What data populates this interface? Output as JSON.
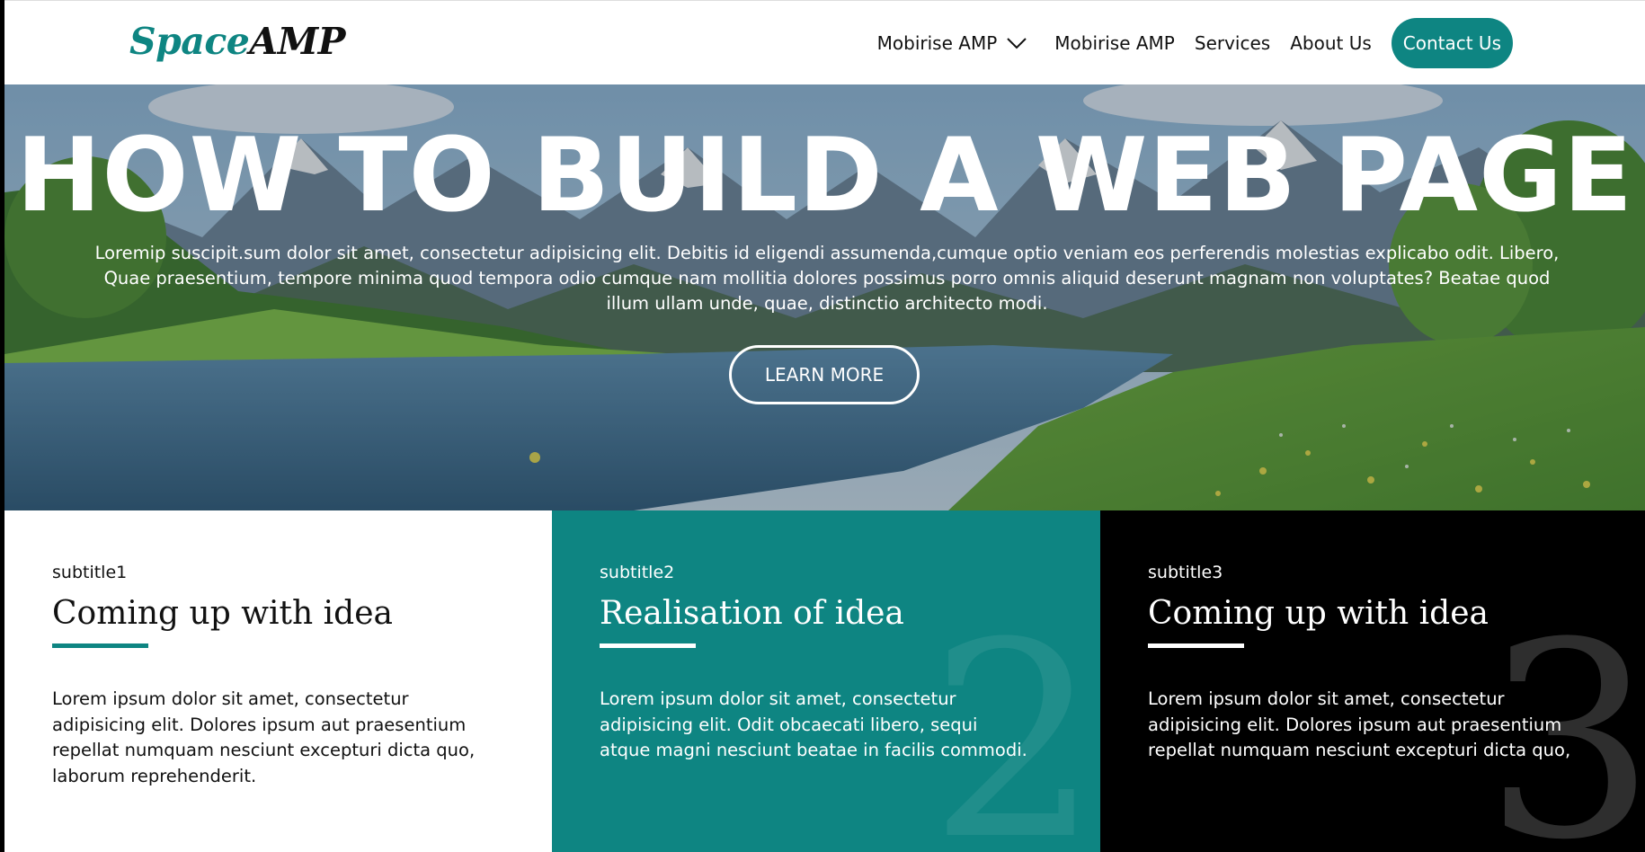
{
  "navbar": {
    "brand_part1": "Space",
    "brand_part2": "AMP",
    "items": [
      {
        "label": "Mobirise AMP",
        "has_dropdown": true
      },
      {
        "label": "Mobirise AMP"
      },
      {
        "label": "Services"
      },
      {
        "label": "About Us"
      }
    ],
    "contact_label": "Contact Us"
  },
  "hero": {
    "title": "HOW TO BUILD A WEB PAGE",
    "text": "Loremip suscipit.sum dolor sit amet, consectetur adipisicing elit. Debitis id eligendi assumenda,cumque optio veniam eos perferendis molestias explicabo odit. Libero, Quae praesentium, tempore minima quod tempora odio cumque nam mollitia dolores possimus porro omnis aliquid deserunt magnam non voluptates? Beatae quod illum ullam unde, quae, distinctio architecto modi.",
    "button_label": "LEARN MORE"
  },
  "cards": [
    {
      "subtitle": "subtitle1",
      "title": "Coming up with idea",
      "body": "Lorem ipsum dolor sit amet, consectetur adipisicing elit. Dolores ipsum aut praesentium repellat numquam nesciunt excepturi dicta quo, laborum reprehenderit.",
      "number": ""
    },
    {
      "subtitle": "subtitle2",
      "title": "Realisation of idea",
      "body": "Lorem ipsum dolor sit amet, consectetur adipisicing elit. Odit obcaecati libero, sequi atque magni nesciunt beatae in facilis commodi.",
      "number": "2"
    },
    {
      "subtitle": "subtitle3",
      "title": "Coming up with idea",
      "body": "Lorem ipsum dolor sit amet, consectetur adipisicing elit. Dolores ipsum aut praesentium repellat numquam nesciunt excepturi dicta quo,",
      "number": "3"
    }
  ],
  "colors": {
    "accent": "#0e8582",
    "dark": "#000000",
    "text": "#111111"
  }
}
